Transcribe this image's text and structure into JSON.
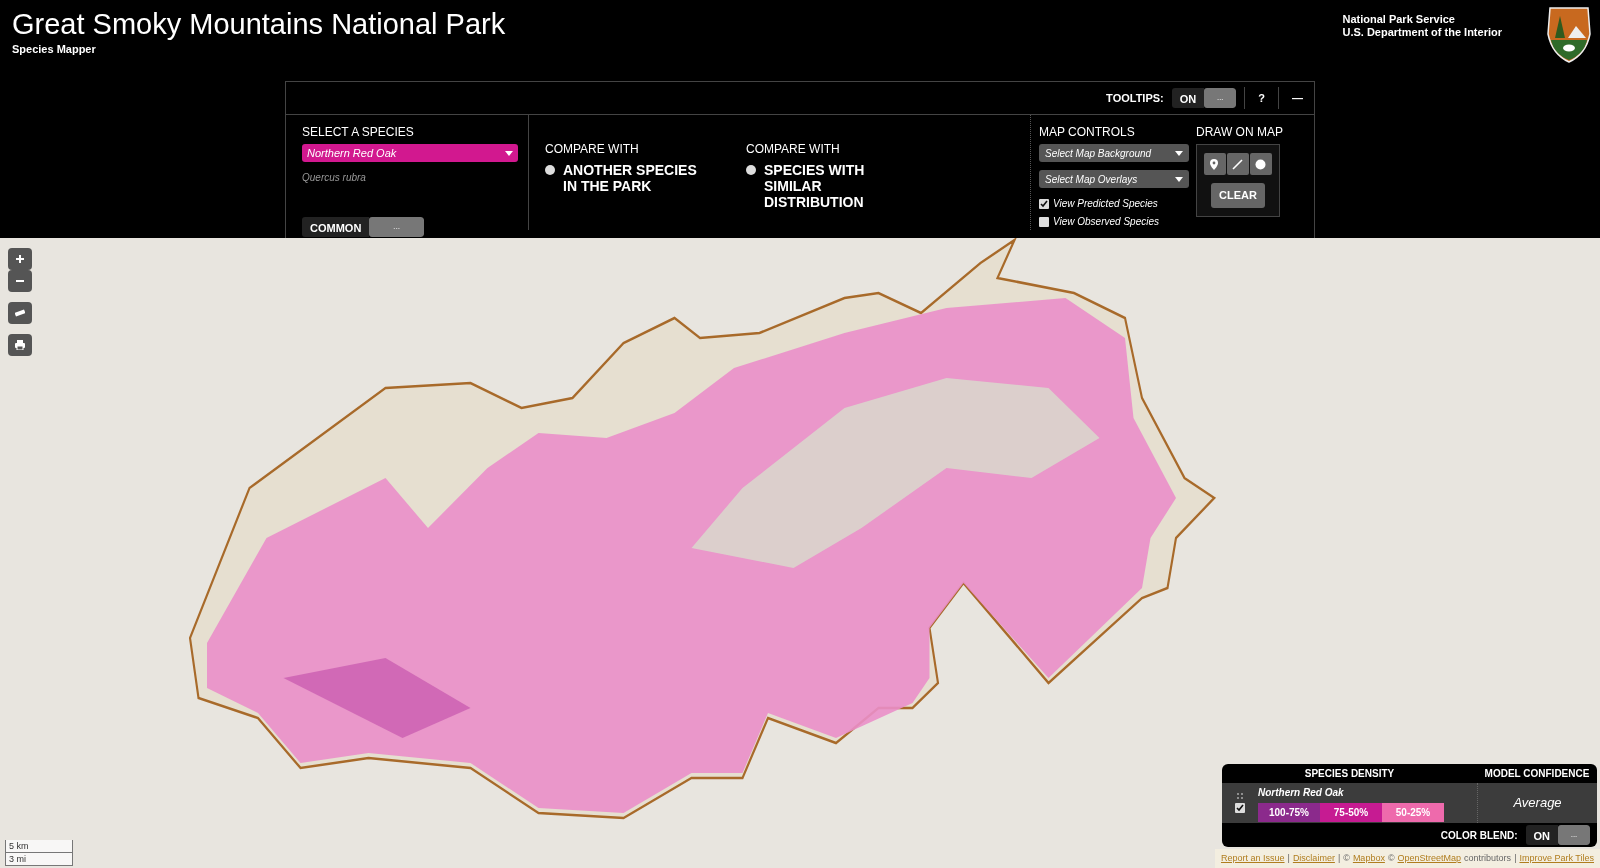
{
  "header": {
    "title": "Great Smoky Mountains National Park",
    "subtitle": "Species Mapper",
    "agency": "National Park Service",
    "department": "U.S. Department of the Interior"
  },
  "toolbar": {
    "tooltips_label": "TOOLTIPS:",
    "tooltips_state": "ON",
    "tooltips_on": true,
    "toggle_dots": "...",
    "help": "?",
    "minimize": "—"
  },
  "species": {
    "heading": "SELECT A SPECIES",
    "selected": "Northern Red Oak",
    "scientific": "Quercus rubra",
    "name_toggle": "COMMON",
    "toggle_dots": "..."
  },
  "compare": [
    {
      "heading": "COMPARE WITH",
      "option": "ANOTHER SPECIES IN THE PARK",
      "selected": false
    },
    {
      "heading": "COMPARE WITH",
      "option": "SPECIES WITH SIMILAR DISTRIBUTION",
      "selected": false
    }
  ],
  "map_controls": {
    "heading": "MAP CONTROLS",
    "dropdowns": [
      {
        "placeholder": "Select Map Background"
      },
      {
        "placeholder": "Select Map Overlays"
      }
    ],
    "checks": [
      {
        "label": "View Predicted Species",
        "checked": true
      },
      {
        "label": "View Observed Species",
        "checked": false
      }
    ]
  },
  "draw": {
    "heading": "DRAW ON MAP",
    "clear": "CLEAR"
  },
  "scale": {
    "metric": "5 km",
    "imperial": "3 mi"
  },
  "legend": {
    "density_heading": "SPECIES DENSITY",
    "confidence_heading": "MODEL CONFIDENCE",
    "species": "Northern Red Oak",
    "checked": true,
    "bins": [
      {
        "label": "100-75%",
        "color": "#8b2a8c"
      },
      {
        "label": "75-50%",
        "color": "#c61b92"
      },
      {
        "label": "50-25%",
        "color": "#ee6aac"
      }
    ],
    "confidence": "Average",
    "blend_label": "COLOR BLEND:",
    "blend_state": "ON",
    "blend_on": true,
    "toggle_dots": "..."
  },
  "attribution": [
    {
      "text": "Report an Issue",
      "kind": "link"
    },
    {
      "text": "|",
      "kind": "sep"
    },
    {
      "text": "Disclaimer",
      "kind": "link"
    },
    {
      "text": "|",
      "kind": "sep"
    },
    {
      "text": "©",
      "kind": "text"
    },
    {
      "text": "Mapbox",
      "kind": "link"
    },
    {
      "text": "©",
      "kind": "text"
    },
    {
      "text": "OpenStreetMap",
      "kind": "link"
    },
    {
      "text": "contributors",
      "kind": "text"
    },
    {
      "text": "|",
      "kind": "sep"
    },
    {
      "text": "Improve Park Tiles",
      "kind": "link"
    }
  ]
}
